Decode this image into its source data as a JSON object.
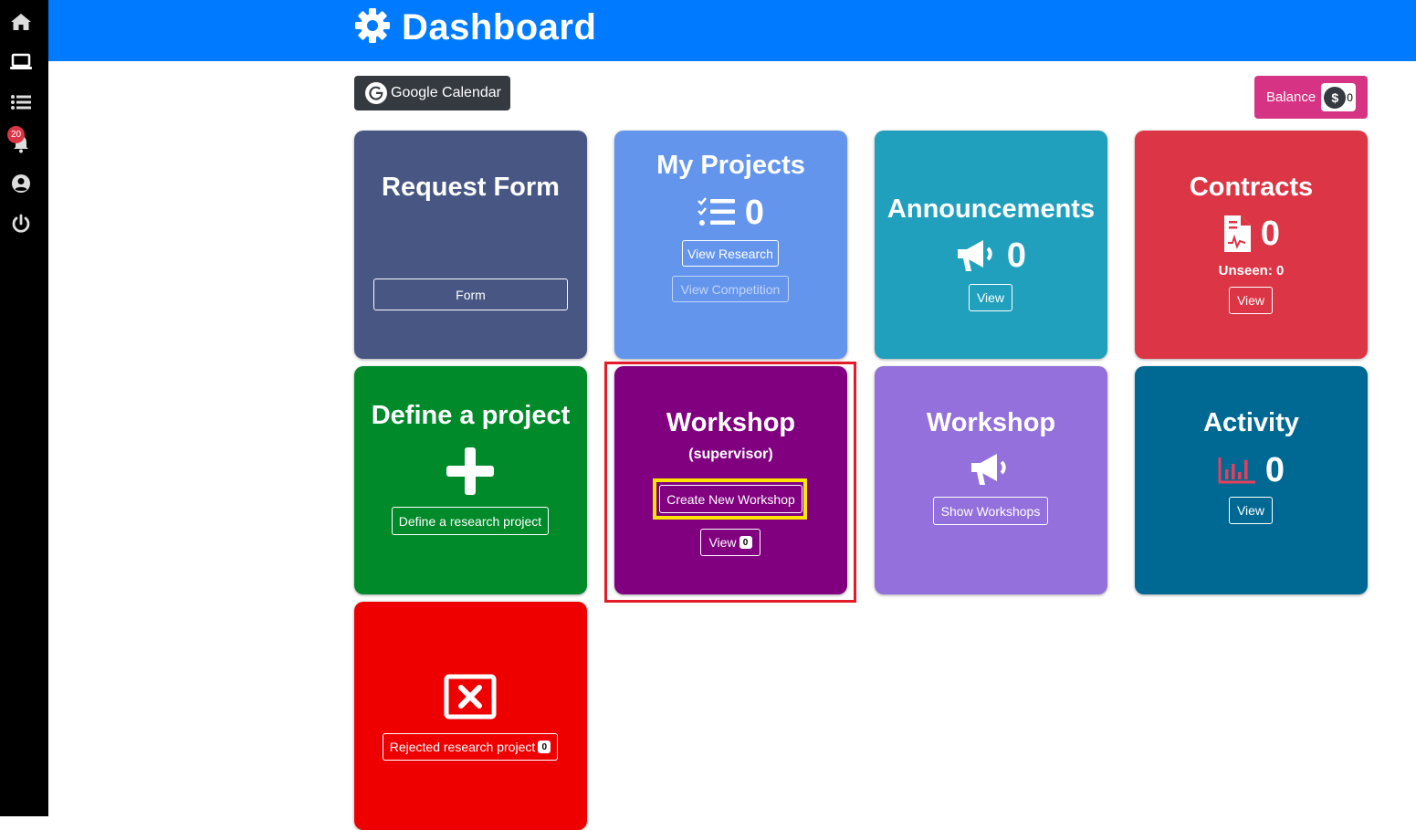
{
  "sidebar": {
    "icons": [
      "home-icon",
      "laptop-icon",
      "list-icon",
      "bell-icon",
      "user-circle-icon",
      "power-icon"
    ],
    "notification_count": "20"
  },
  "header": {
    "title": "Dashboard",
    "icon": "gear-icon",
    "color": "#007bff"
  },
  "toolbar": {
    "google_calendar_label": "Google Calendar",
    "balance_label": "Balance",
    "balance_currency": "$",
    "balance_value": "0"
  },
  "cards": {
    "request_form": {
      "title": "Request Form",
      "button": "Form",
      "color": "#475683"
    },
    "my_projects": {
      "title": "My Projects",
      "count": "0",
      "button1": "View Research",
      "button2": "View Competition",
      "color": "#6495ed"
    },
    "announcements": {
      "title": "Announcements",
      "count": "0",
      "button": "View",
      "color": "#20a0bd"
    },
    "contracts": {
      "title": "Contracts",
      "count": "0",
      "unseen": "Unseen: 0",
      "button": "View",
      "color": "#dc3545"
    },
    "define_project": {
      "title": "Define a project",
      "button": "Define a research project",
      "color": "#008a2a"
    },
    "workshop_supervisor": {
      "title": "Workshop",
      "subtitle": "(supervisor)",
      "create_button": "Create New Workshop",
      "view_button": "View",
      "view_count": "0",
      "color": "#800080"
    },
    "workshop": {
      "title": "Workshop",
      "button": "Show Workshops",
      "color": "#9370db"
    },
    "activity": {
      "title": "Activity",
      "count": "0",
      "button": "View",
      "color": "#006993"
    },
    "rejected": {
      "button": "Rejected research project",
      "count": "0",
      "color": "#ee0000"
    }
  }
}
